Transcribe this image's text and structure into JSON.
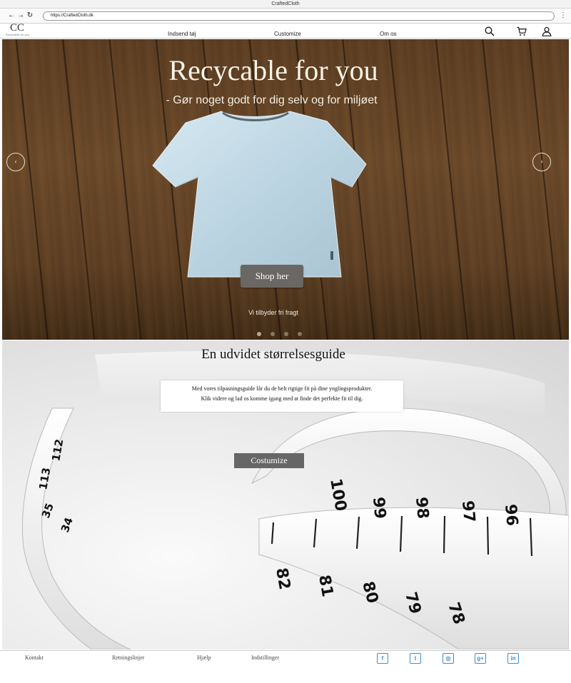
{
  "browser": {
    "window_title": "CraftedCloth",
    "url": "https://CraftedCloth.dk",
    "back_glyph": "←",
    "forward_glyph": "→",
    "reload_glyph": "↻",
    "menu_glyph": "⋮"
  },
  "header": {
    "logo_mark": "CC",
    "logo_tagline": "Recyclable for you",
    "nav": [
      "Indsend tøj",
      "Customize",
      "Om os"
    ],
    "icons": [
      "search-icon",
      "cart-icon",
      "user-icon"
    ]
  },
  "hero": {
    "title": "Recycable for you",
    "subtitle": "- Gør noget godt for dig selv og for miljøet",
    "prev_glyph": "‹",
    "next_glyph": "›",
    "cta_label": "Shop her",
    "note": "Vi tilbyder fri fragt",
    "slide_count": 4,
    "active_slide": 1
  },
  "guide": {
    "title": "En udvidet størrelsesguide",
    "text_lines": [
      "Med vores tilpasningsguide får du de helt rigtige fit på dine ynglingsprodukter.",
      "Klik videre og lad os komme igang med at finde det perfekte fit til dig."
    ],
    "cta_label": "Costumize"
  },
  "footer": {
    "links": [
      "Kontakt",
      "Retningslinjer",
      "Hjælp",
      "Indstillinger"
    ],
    "social": [
      {
        "name": "facebook-icon",
        "glyph": "f"
      },
      {
        "name": "twitter-icon",
        "glyph": "t"
      },
      {
        "name": "instagram-icon",
        "glyph": "◎"
      },
      {
        "name": "google-plus-icon",
        "glyph": "g+"
      },
      {
        "name": "linkedin-icon",
        "glyph": "in"
      }
    ]
  },
  "colors": {
    "hero_button": "#6a6764",
    "guide_button": "#666666",
    "social_accent": "#3b8fd4"
  }
}
